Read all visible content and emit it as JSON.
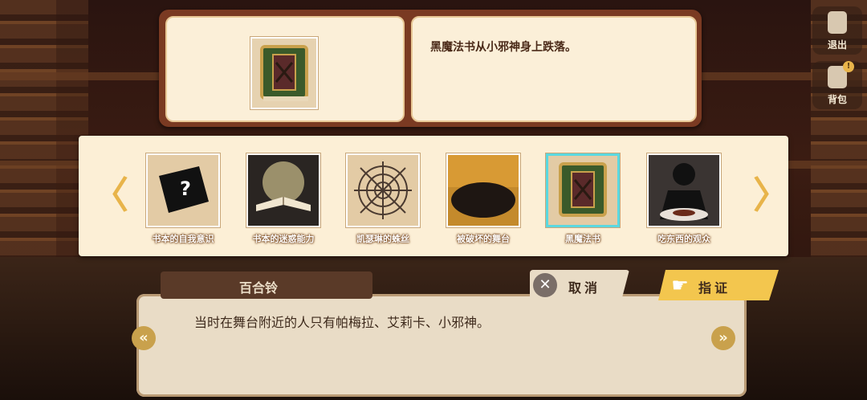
{
  "selected_item": {
    "name_icon": "black-magic-book-icon",
    "description": "黑魔法书从小邪神身上跌落。"
  },
  "side_menu": {
    "exit_label": "退出",
    "bag_label": "背包",
    "bag_badge": "!"
  },
  "evidence": {
    "prev_arrow": "〈",
    "next_arrow": "〉",
    "items": [
      {
        "label": "书本的自我意识",
        "icon": "silhouette-book-question-icon"
      },
      {
        "label": "书本的迷惑能力",
        "icon": "glowing-open-book-icon"
      },
      {
        "label": "凯瑟琳的蛛丝",
        "icon": "spider-web-icon"
      },
      {
        "label": "被破坏的舞台",
        "icon": "broken-stage-icon"
      },
      {
        "label": "黑魔法书",
        "icon": "black-magic-book-icon"
      },
      {
        "label": "吃东西的观众",
        "icon": "eating-audience-icon"
      }
    ],
    "selected_index": 4
  },
  "dialogue": {
    "speaker": "百合铃",
    "text": "当时在舞台附近的人只有帕梅拉、艾莉卡、小邪神。",
    "prev": "«",
    "next": "»"
  },
  "actions": {
    "cancel_label": "取消",
    "cancel_icon_glyph": "✕",
    "confirm_label": "指证",
    "confirm_icon_glyph": "☛"
  }
}
